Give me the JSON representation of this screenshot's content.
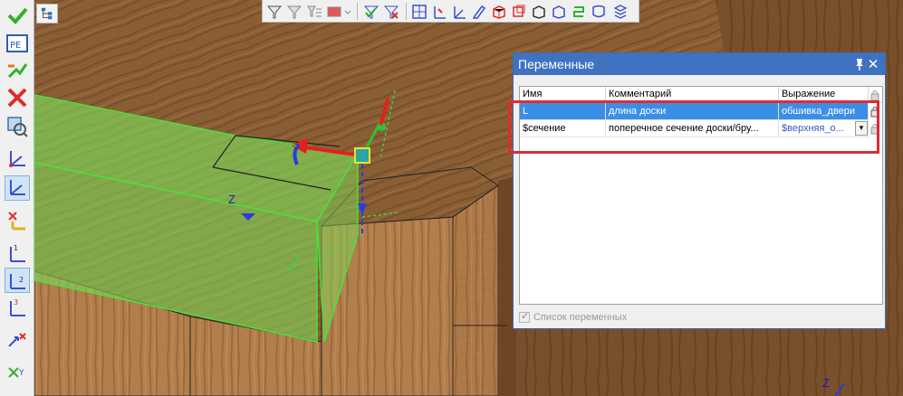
{
  "panel": {
    "title": "Переменные",
    "columns": [
      "Имя",
      "Комментарий",
      "Выражение"
    ],
    "rows": [
      {
        "name": "L",
        "comment": "длина доски",
        "expression": "обшивка_двери",
        "selected": true
      },
      {
        "name": "$сечение",
        "comment": "поперечное сечение доски/бру...",
        "expression": "$верхняя_о...",
        "selected": false
      }
    ],
    "footer_label": "Список переменных",
    "footer_checked": true
  },
  "viewport": {
    "axis_labels": [
      "Z",
      "Z"
    ]
  },
  "icons": {
    "pin": "pin-icon",
    "close": "close-icon",
    "lock": "lock-icon"
  },
  "colors": {
    "panel_title_bg": "#3f73c1",
    "selection": "#3a8ee6",
    "highlight": "#e02a36",
    "green_selection": "#7ed957"
  }
}
